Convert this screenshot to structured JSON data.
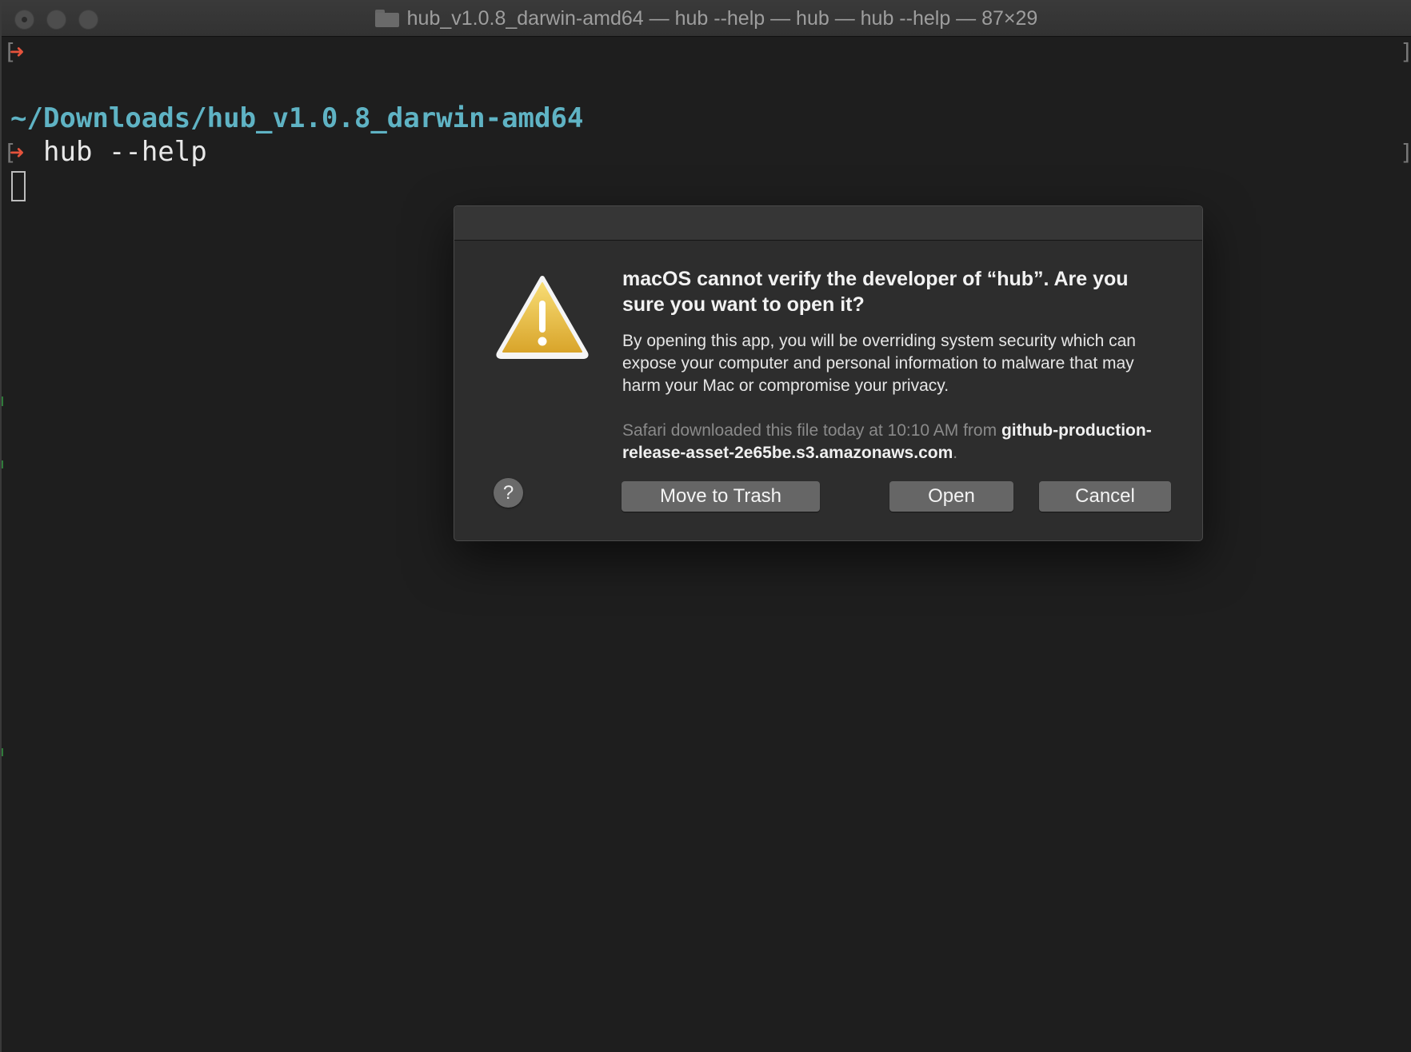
{
  "window": {
    "title": "hub_v1.0.8_darwin-amd64 — hub --help — hub — hub --help — 87×29"
  },
  "terminal": {
    "prompt_glyph": "➜",
    "path": "~/Downloads/hub_v1.0.8_darwin-amd64",
    "command": "hub --help"
  },
  "dialog": {
    "heading": "macOS cannot verify the developer of “hub”. Are you sure you want to open it?",
    "body": "By opening this app, you will be overriding system security which can expose your computer and personal information to malware that may harm your Mac or compromise your privacy.",
    "source_prefix": "Safari downloaded this file today at 10:10 AM from ",
    "source_host": "github-production-release-asset-2e65be.s3.amazonaws.com",
    "source_suffix": ".",
    "help_label": "?",
    "buttons": {
      "move_to_trash": "Move to Trash",
      "open": "Open",
      "cancel": "Cancel"
    }
  },
  "colors": {
    "terminal_bg": "#1e1e1e",
    "path_color": "#5fb3c4",
    "prompt_color": "#e5533c",
    "dialog_bg": "#2d2d2d",
    "button_bg": "#666666",
    "warning_yellow": "#f0c84a"
  }
}
